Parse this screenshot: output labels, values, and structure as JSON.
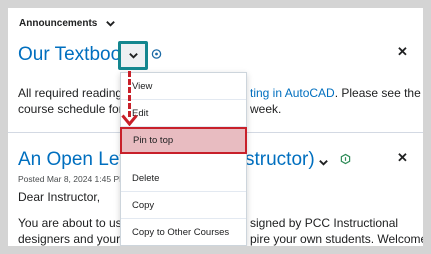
{
  "widget": {
    "title": "Announcements"
  },
  "post1": {
    "title": "Our Textbook",
    "body_line1_start": "All required reading w",
    "body_line1_link": "ting in AutoCAD",
    "body_line1_end": ". Please see the",
    "body_line2_start": "course schedule for de",
    "body_line2_end": "week."
  },
  "post2": {
    "title_start": "An Open Lette",
    "title_end": "structor)",
    "meta": "Posted Mar 8, 2024 1:45 PM",
    "greeting": "Dear Instructor,",
    "body_line1_start": "You are about to use s",
    "body_line1_end": "signed by PCC Instructional",
    "body_line2_start": "designers and your fac",
    "body_line2_end": "pire your own students. Welcome!"
  },
  "menu": {
    "items": [
      {
        "label": "View"
      },
      {
        "label": "Edit"
      },
      {
        "label": "Pin to top"
      },
      {
        "label": "Delete"
      },
      {
        "label": "Copy"
      },
      {
        "label": "Copy to Other Courses"
      }
    ]
  },
  "colors": {
    "link": "#006fbf",
    "highlight_border": "#c8202a",
    "focus_ring": "#14868f"
  }
}
